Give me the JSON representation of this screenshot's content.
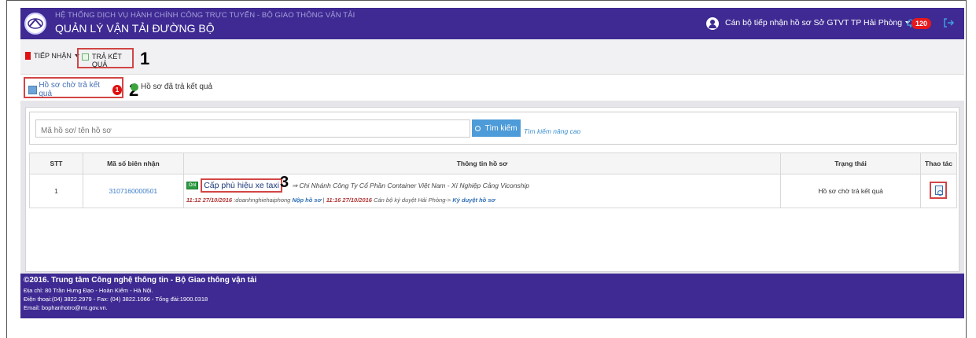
{
  "header": {
    "system_title": "HỆ THỐNG DỊCH VỤ HÀNH CHÍNH CÔNG TRỰC TUYẾN - BỘ GIAO THÔNG VẬN TẢI",
    "app_title": "QUẢN LÝ VẬN TẢI ĐƯỜNG BỘ",
    "user_name": "Cán bộ tiếp nhận hồ sơ Sở GTVT TP Hải Phòng",
    "notification_count": "120"
  },
  "toolbar": {
    "receive_label": "TIẾP NHẬN",
    "return_label": "TRẢ KẾT QUẢ"
  },
  "subtabs": {
    "pending_label": "Hồ sơ chờ trả kết quả",
    "pending_count": "1",
    "returned_label": "Hồ sơ đã trả kết quả"
  },
  "search": {
    "placeholder": "Mã hồ sơ/ tên hồ sơ",
    "button_label": "Tìm kiếm",
    "advanced_label": "Tìm kiếm nâng cao"
  },
  "table": {
    "headers": {
      "stt": "STT",
      "receipt_code": "Mã số biên nhận",
      "info": "Thông tin hồ sơ",
      "status": "Trạng thái",
      "actions": "Thao tác"
    },
    "rows": [
      {
        "stt": "1",
        "receipt_code": "3107160000501",
        "online_tag": "Onl",
        "service": "Cấp phù hiệu xe taxi",
        "company": "⇒ Chi Nhánh Công Ty Cổ Phần Container Việt Nam - Xí Nghiệp Cảng Viconship",
        "time1": "11:12 27/10/2016",
        "actor1": ":doanhnghiehaiphong",
        "action1": "Nộp hồ sơ",
        "separator": "|",
        "time2": "11:16 27/10/2016",
        "actor2": "Cán bộ ký duyệt Hải Phòng->",
        "action2": "Ký duyệt hồ sơ",
        "status": "Hồ sơ chờ trả kết quả"
      }
    ]
  },
  "callouts": [
    "1",
    "2",
    "3"
  ],
  "footer": {
    "line1": "©2016. Trung tâm Công nghệ thông tin - Bộ Giao thông vận tải",
    "line2": "Địa chỉ: 80 Trần Hưng Đạo - Hoàn Kiếm - Hà Nội.",
    "line3": "Điện thoại:(04) 3822.2979 - Fax: (04) 3822.1066 - Tổng đài:1900.0318",
    "line4": "Email: bophanhotro@mt.gov.vn."
  },
  "colors": {
    "header_bg": "#3e2a92",
    "highlight_border": "#d24545",
    "search_button": "#4d9bd8",
    "badge_red": "#e8181b"
  }
}
